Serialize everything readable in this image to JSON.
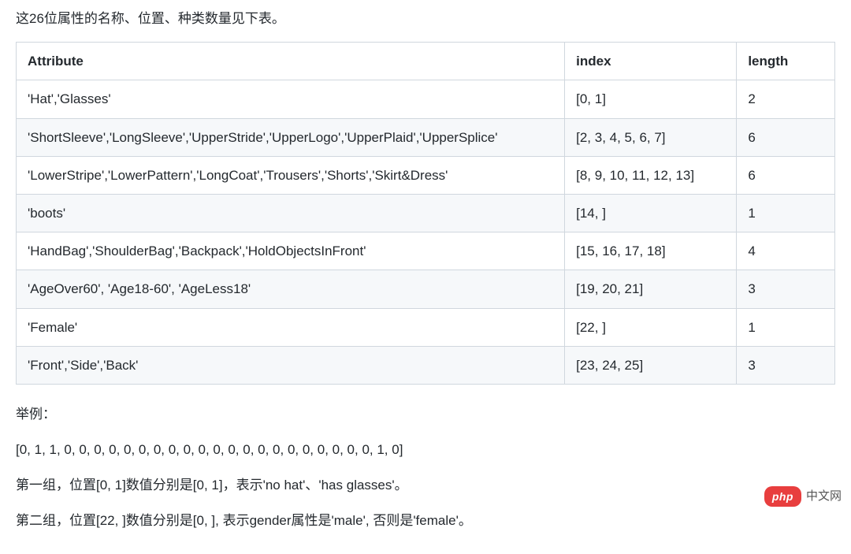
{
  "intro": "这26位属性的名称、位置、种类数量见下表。",
  "table": {
    "headers": {
      "attribute": "Attribute",
      "index": "index",
      "length": "length"
    },
    "rows": [
      {
        "attribute": "'Hat','Glasses'",
        "index": "[0, 1]",
        "length": "2"
      },
      {
        "attribute": "'ShortSleeve','LongSleeve','UpperStride','UpperLogo','UpperPlaid','UpperSplice'",
        "index": "[2, 3, 4, 5, 6, 7]",
        "length": "6"
      },
      {
        "attribute": "'LowerStripe','LowerPattern','LongCoat','Trousers','Shorts','Skirt&Dress'",
        "index": "[8, 9, 10, 11, 12, 13]",
        "length": "6"
      },
      {
        "attribute": "'boots'",
        "index": "[14, ]",
        "length": "1"
      },
      {
        "attribute": "'HandBag','ShoulderBag','Backpack','HoldObjectsInFront'",
        "index": "[15, 16, 17, 18]",
        "length": "4"
      },
      {
        "attribute": "'AgeOver60', 'Age18-60', 'AgeLess18'",
        "index": "[19, 20, 21]",
        "length": "3"
      },
      {
        "attribute": "'Female'",
        "index": "[22, ]",
        "length": "1"
      },
      {
        "attribute": "'Front','Side','Back'",
        "index": "[23, 24, 25]",
        "length": "3"
      }
    ]
  },
  "example": {
    "label": "举例：",
    "vector": "[0, 1, 1, 0, 0, 0, 0, 0, 0, 0, 0, 0, 0, 0, 0, 0, 0, 0, 0, 0, 0, 0, 0, 0, 1, 0]",
    "group1": "第一组，位置[0, 1]数值分别是[0, 1]，表示'no hat'、'has glasses'。",
    "group2": "第二组，位置[22, ]数值分别是[0, ], 表示gender属性是'male', 否则是'female'。"
  },
  "watermark": {
    "badge": "php",
    "text": "中文网"
  }
}
